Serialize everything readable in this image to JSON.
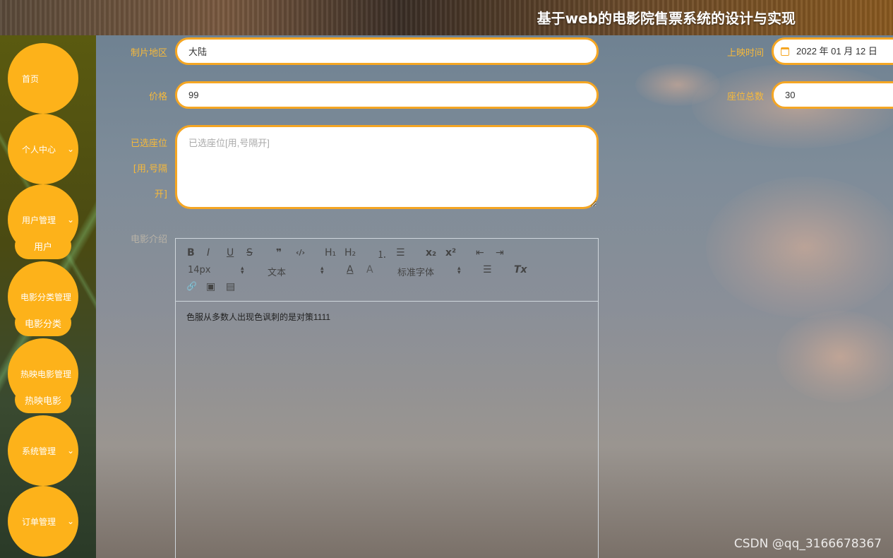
{
  "header": {
    "title": "基于web的电影院售票系统的设计与实现"
  },
  "sidebar": {
    "items": [
      {
        "label": "首页"
      },
      {
        "label": "个人中心"
      },
      {
        "label": "用户管理",
        "sub": "用户"
      },
      {
        "label": "电影分类管理",
        "sub": "电影分类"
      },
      {
        "label": "热映电影管理",
        "sub": "热映电影"
      },
      {
        "label": "系统管理"
      },
      {
        "label": "订单管理"
      }
    ],
    "chevron_icon": "chevron-down-icon"
  },
  "form": {
    "region_label": "制片地区",
    "region_value": "大陆",
    "release_label": "上映时间",
    "release_value": "2022 年 01 月 12 日",
    "price_label": "价格",
    "price_value": "99",
    "seats_total_label": "座位总数",
    "seats_total_value": "30",
    "selected_seats_label_1": "已选座位",
    "selected_seats_label_2": "[用,号隔",
    "selected_seats_label_3": "开]",
    "selected_seats_placeholder": "已选座位[用,号隔开]",
    "intro_label": "电影介绍"
  },
  "editor": {
    "toolbar": {
      "bold": "B",
      "italic": "I",
      "underline": "U",
      "strike": "S",
      "quote": "❞",
      "code": "‹/›",
      "h1": "H₁",
      "h2": "H₂",
      "ordered_list": "⒈",
      "bullet_list": "☰",
      "subscript": "x₂",
      "superscript": "x²",
      "outdent": "⇤",
      "indent": "⇥",
      "size_select": "14px",
      "header_select": "文本",
      "color": "A",
      "background": "A",
      "font_select": "标准字体",
      "align": "☰",
      "clean": "Tx",
      "link": "🔗",
      "image": "▣",
      "video": "▤"
    },
    "content": "色服从多数人出现色讽刺的是对策1111"
  },
  "watermark": "CSDN @qq_3166678367",
  "colors": {
    "accent": "#fdb21a",
    "border": "#f5a623",
    "label": "#f6b93b"
  }
}
